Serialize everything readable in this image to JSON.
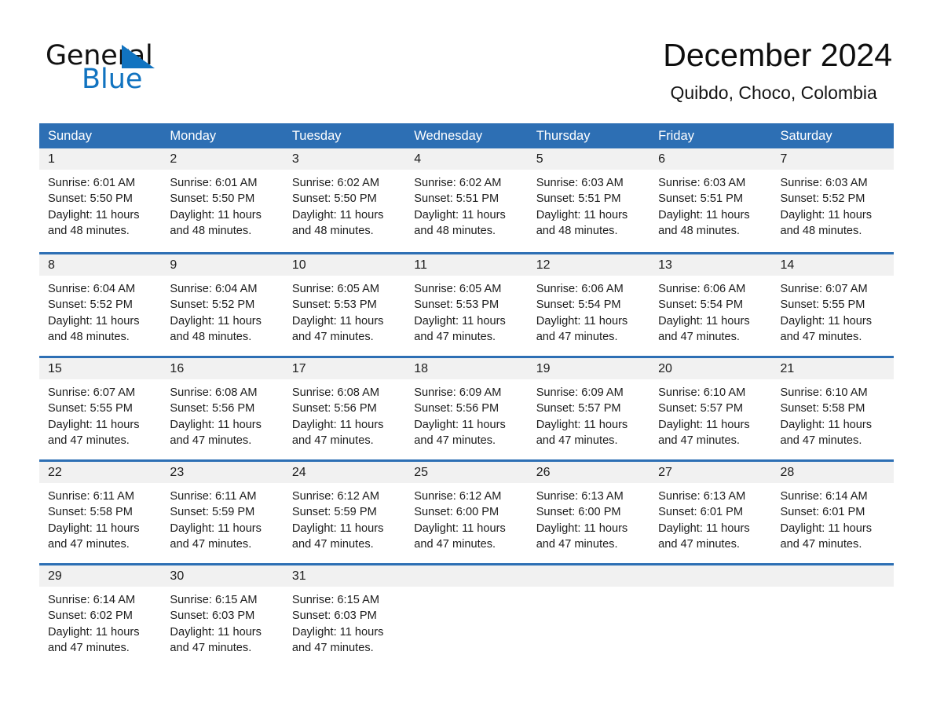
{
  "brand": {
    "name_part1": "General",
    "name_part2": "Blue",
    "triangle_color": "#1173c0"
  },
  "header": {
    "title": "December 2024",
    "subtitle": "Quibdo, Choco, Colombia",
    "accent_color": "#2d6fb4",
    "daynum_band_color": "#f1f1f1"
  },
  "weekdays": [
    "Sunday",
    "Monday",
    "Tuesday",
    "Wednesday",
    "Thursday",
    "Friday",
    "Saturday"
  ],
  "weeks": [
    {
      "days": [
        {
          "date": "1",
          "sunrise": "Sunrise: 6:01 AM",
          "sunset": "Sunset: 5:50 PM",
          "daylight_line1": "Daylight: 11 hours",
          "daylight_line2": "and 48 minutes."
        },
        {
          "date": "2",
          "sunrise": "Sunrise: 6:01 AM",
          "sunset": "Sunset: 5:50 PM",
          "daylight_line1": "Daylight: 11 hours",
          "daylight_line2": "and 48 minutes."
        },
        {
          "date": "3",
          "sunrise": "Sunrise: 6:02 AM",
          "sunset": "Sunset: 5:50 PM",
          "daylight_line1": "Daylight: 11 hours",
          "daylight_line2": "and 48 minutes."
        },
        {
          "date": "4",
          "sunrise": "Sunrise: 6:02 AM",
          "sunset": "Sunset: 5:51 PM",
          "daylight_line1": "Daylight: 11 hours",
          "daylight_line2": "and 48 minutes."
        },
        {
          "date": "5",
          "sunrise": "Sunrise: 6:03 AM",
          "sunset": "Sunset: 5:51 PM",
          "daylight_line1": "Daylight: 11 hours",
          "daylight_line2": "and 48 minutes."
        },
        {
          "date": "6",
          "sunrise": "Sunrise: 6:03 AM",
          "sunset": "Sunset: 5:51 PM",
          "daylight_line1": "Daylight: 11 hours",
          "daylight_line2": "and 48 minutes."
        },
        {
          "date": "7",
          "sunrise": "Sunrise: 6:03 AM",
          "sunset": "Sunset: 5:52 PM",
          "daylight_line1": "Daylight: 11 hours",
          "daylight_line2": "and 48 minutes."
        }
      ]
    },
    {
      "days": [
        {
          "date": "8",
          "sunrise": "Sunrise: 6:04 AM",
          "sunset": "Sunset: 5:52 PM",
          "daylight_line1": "Daylight: 11 hours",
          "daylight_line2": "and 48 minutes."
        },
        {
          "date": "9",
          "sunrise": "Sunrise: 6:04 AM",
          "sunset": "Sunset: 5:52 PM",
          "daylight_line1": "Daylight: 11 hours",
          "daylight_line2": "and 48 minutes."
        },
        {
          "date": "10",
          "sunrise": "Sunrise: 6:05 AM",
          "sunset": "Sunset: 5:53 PM",
          "daylight_line1": "Daylight: 11 hours",
          "daylight_line2": "and 47 minutes."
        },
        {
          "date": "11",
          "sunrise": "Sunrise: 6:05 AM",
          "sunset": "Sunset: 5:53 PM",
          "daylight_line1": "Daylight: 11 hours",
          "daylight_line2": "and 47 minutes."
        },
        {
          "date": "12",
          "sunrise": "Sunrise: 6:06 AM",
          "sunset": "Sunset: 5:54 PM",
          "daylight_line1": "Daylight: 11 hours",
          "daylight_line2": "and 47 minutes."
        },
        {
          "date": "13",
          "sunrise": "Sunrise: 6:06 AM",
          "sunset": "Sunset: 5:54 PM",
          "daylight_line1": "Daylight: 11 hours",
          "daylight_line2": "and 47 minutes."
        },
        {
          "date": "14",
          "sunrise": "Sunrise: 6:07 AM",
          "sunset": "Sunset: 5:55 PM",
          "daylight_line1": "Daylight: 11 hours",
          "daylight_line2": "and 47 minutes."
        }
      ]
    },
    {
      "days": [
        {
          "date": "15",
          "sunrise": "Sunrise: 6:07 AM",
          "sunset": "Sunset: 5:55 PM",
          "daylight_line1": "Daylight: 11 hours",
          "daylight_line2": "and 47 minutes."
        },
        {
          "date": "16",
          "sunrise": "Sunrise: 6:08 AM",
          "sunset": "Sunset: 5:56 PM",
          "daylight_line1": "Daylight: 11 hours",
          "daylight_line2": "and 47 minutes."
        },
        {
          "date": "17",
          "sunrise": "Sunrise: 6:08 AM",
          "sunset": "Sunset: 5:56 PM",
          "daylight_line1": "Daylight: 11 hours",
          "daylight_line2": "and 47 minutes."
        },
        {
          "date": "18",
          "sunrise": "Sunrise: 6:09 AM",
          "sunset": "Sunset: 5:56 PM",
          "daylight_line1": "Daylight: 11 hours",
          "daylight_line2": "and 47 minutes."
        },
        {
          "date": "19",
          "sunrise": "Sunrise: 6:09 AM",
          "sunset": "Sunset: 5:57 PM",
          "daylight_line1": "Daylight: 11 hours",
          "daylight_line2": "and 47 minutes."
        },
        {
          "date": "20",
          "sunrise": "Sunrise: 6:10 AM",
          "sunset": "Sunset: 5:57 PM",
          "daylight_line1": "Daylight: 11 hours",
          "daylight_line2": "and 47 minutes."
        },
        {
          "date": "21",
          "sunrise": "Sunrise: 6:10 AM",
          "sunset": "Sunset: 5:58 PM",
          "daylight_line1": "Daylight: 11 hours",
          "daylight_line2": "and 47 minutes."
        }
      ]
    },
    {
      "days": [
        {
          "date": "22",
          "sunrise": "Sunrise: 6:11 AM",
          "sunset": "Sunset: 5:58 PM",
          "daylight_line1": "Daylight: 11 hours",
          "daylight_line2": "and 47 minutes."
        },
        {
          "date": "23",
          "sunrise": "Sunrise: 6:11 AM",
          "sunset": "Sunset: 5:59 PM",
          "daylight_line1": "Daylight: 11 hours",
          "daylight_line2": "and 47 minutes."
        },
        {
          "date": "24",
          "sunrise": "Sunrise: 6:12 AM",
          "sunset": "Sunset: 5:59 PM",
          "daylight_line1": "Daylight: 11 hours",
          "daylight_line2": "and 47 minutes."
        },
        {
          "date": "25",
          "sunrise": "Sunrise: 6:12 AM",
          "sunset": "Sunset: 6:00 PM",
          "daylight_line1": "Daylight: 11 hours",
          "daylight_line2": "and 47 minutes."
        },
        {
          "date": "26",
          "sunrise": "Sunrise: 6:13 AM",
          "sunset": "Sunset: 6:00 PM",
          "daylight_line1": "Daylight: 11 hours",
          "daylight_line2": "and 47 minutes."
        },
        {
          "date": "27",
          "sunrise": "Sunrise: 6:13 AM",
          "sunset": "Sunset: 6:01 PM",
          "daylight_line1": "Daylight: 11 hours",
          "daylight_line2": "and 47 minutes."
        },
        {
          "date": "28",
          "sunrise": "Sunrise: 6:14 AM",
          "sunset": "Sunset: 6:01 PM",
          "daylight_line1": "Daylight: 11 hours",
          "daylight_line2": "and 47 minutes."
        }
      ]
    },
    {
      "days": [
        {
          "date": "29",
          "sunrise": "Sunrise: 6:14 AM",
          "sunset": "Sunset: 6:02 PM",
          "daylight_line1": "Daylight: 11 hours",
          "daylight_line2": "and 47 minutes."
        },
        {
          "date": "30",
          "sunrise": "Sunrise: 6:15 AM",
          "sunset": "Sunset: 6:03 PM",
          "daylight_line1": "Daylight: 11 hours",
          "daylight_line2": "and 47 minutes."
        },
        {
          "date": "31",
          "sunrise": "Sunrise: 6:15 AM",
          "sunset": "Sunset: 6:03 PM",
          "daylight_line1": "Daylight: 11 hours",
          "daylight_line2": "and 47 minutes."
        },
        {
          "date": "",
          "sunrise": "",
          "sunset": "",
          "daylight_line1": "",
          "daylight_line2": ""
        },
        {
          "date": "",
          "sunrise": "",
          "sunset": "",
          "daylight_line1": "",
          "daylight_line2": ""
        },
        {
          "date": "",
          "sunrise": "",
          "sunset": "",
          "daylight_line1": "",
          "daylight_line2": ""
        },
        {
          "date": "",
          "sunrise": "",
          "sunset": "",
          "daylight_line1": "",
          "daylight_line2": ""
        }
      ]
    }
  ]
}
